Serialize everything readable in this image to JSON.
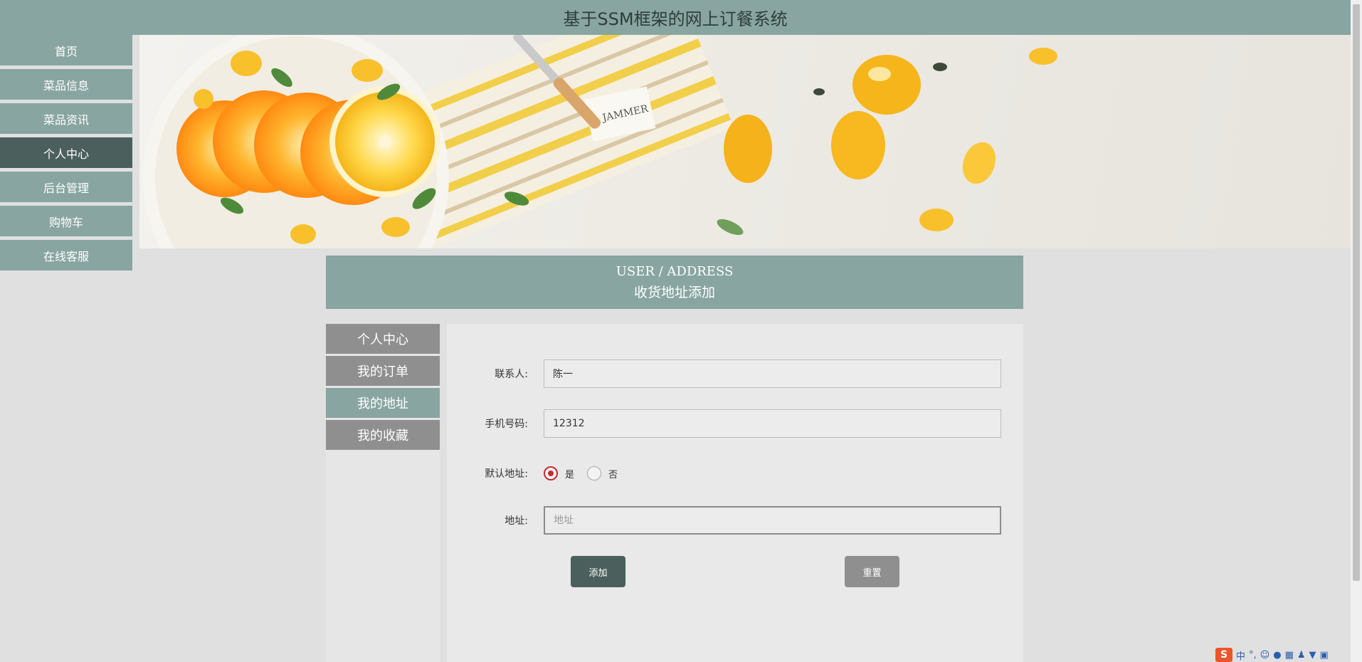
{
  "header": {
    "title": "基于SSM框架的网上订餐系统"
  },
  "nav": {
    "items": [
      {
        "label": "首页"
      },
      {
        "label": "菜品信息"
      },
      {
        "label": "菜品资讯"
      },
      {
        "label": "个人中心"
      },
      {
        "label": "后台管理"
      },
      {
        "label": "购物车"
      },
      {
        "label": "在线客服"
      }
    ],
    "active_label": "个人中心"
  },
  "banner": {
    "label": "JAMMER"
  },
  "section": {
    "title_en": "USER / ADDRESS",
    "title_cn": "收货地址添加"
  },
  "sidebar": {
    "items": [
      {
        "label": "个人中心"
      },
      {
        "label": "我的订单"
      },
      {
        "label": "我的地址"
      },
      {
        "label": "我的收藏"
      }
    ],
    "active_label": "我的地址"
  },
  "form": {
    "contact": {
      "label": "联系人:",
      "value": "陈一"
    },
    "phone": {
      "label": "手机号码:",
      "value": "12312"
    },
    "default_address": {
      "label": "默认地址:",
      "options": [
        {
          "label": "是"
        },
        {
          "label": "否"
        }
      ],
      "selected": "是"
    },
    "address": {
      "label": "地址:",
      "value": "",
      "placeholder": "地址"
    },
    "submit_label": "添加",
    "reset_label": "重置"
  },
  "ime": {
    "logo": "S",
    "mode": "中"
  },
  "colors": {
    "primary": "#88a5a1",
    "primary_dark": "#4b605d",
    "secondary": "#8f8f8f",
    "radio_accent": "#c0302f"
  }
}
